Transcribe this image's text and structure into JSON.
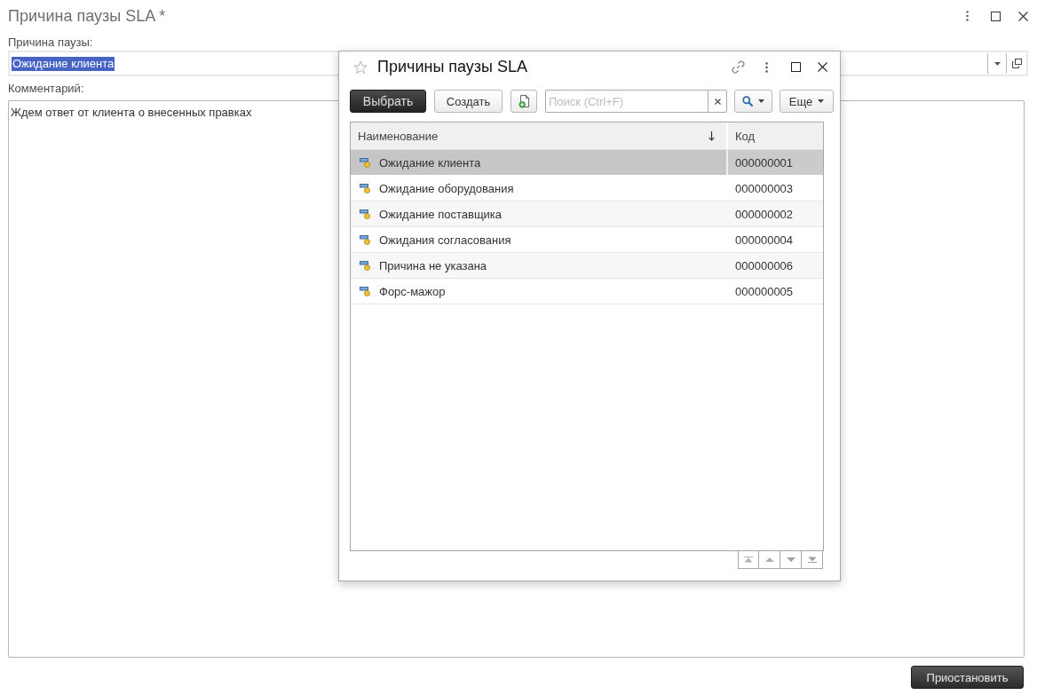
{
  "window": {
    "title": "Причина паузы SLA *"
  },
  "form": {
    "reason_field": {
      "label": "Причина паузы:",
      "value": "Ожидание клиента",
      "highlighted": true
    },
    "comment_field": {
      "label": "Комментарий:",
      "value": "Ждем ответ от клиента о внесенных правках"
    },
    "submit_button": "Приостановить"
  },
  "dialog": {
    "title": "Причины паузы SLA",
    "favorite": false,
    "toolbar": {
      "select_button": "Выбрать",
      "create_button": "Создать",
      "search": {
        "placeholder": "Поиск (Ctrl+F)"
      },
      "more_button": "Еще"
    },
    "table": {
      "columns": [
        {
          "label": "Наименование",
          "sorted": true
        },
        {
          "label": "Код",
          "sorted": false
        }
      ],
      "rows": [
        {
          "name": "Ожидание клиента",
          "code": "000000001",
          "selected": true
        },
        {
          "name": "Ожидание оборудования",
          "code": "000000003",
          "selected": false
        },
        {
          "name": "Ожидание поставщика",
          "code": "000000002",
          "selected": false
        },
        {
          "name": "Ожидания согласования",
          "code": "000000004",
          "selected": false
        },
        {
          "name": "Причина не указана",
          "code": "000000006",
          "selected": false
        },
        {
          "name": "Форс-мажор",
          "code": "000000005",
          "selected": false
        }
      ]
    }
  }
}
